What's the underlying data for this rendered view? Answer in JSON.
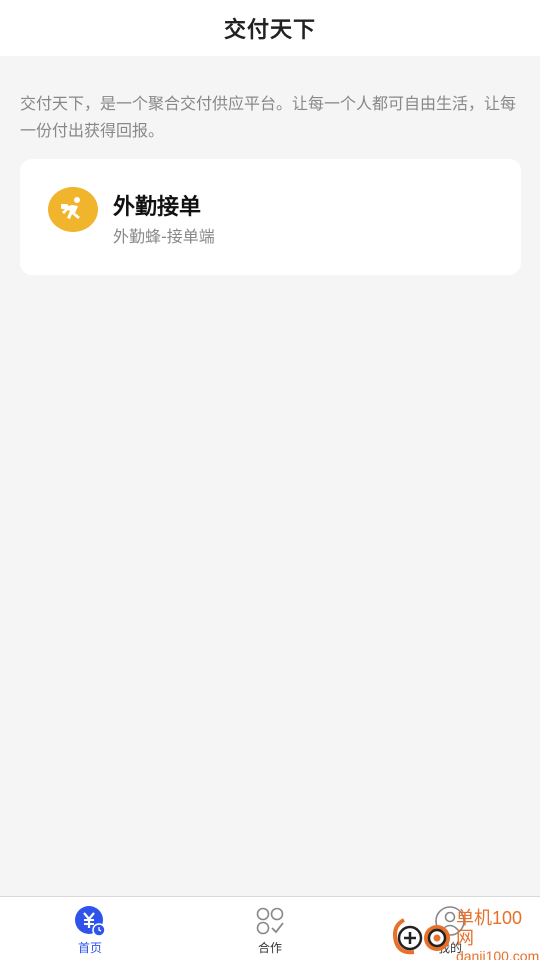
{
  "header": {
    "title": "交付天下"
  },
  "intro": {
    "text": "交付天下，是一个聚合交付供应平台。让每一个人都可自由生活，让每一份付出获得回报。"
  },
  "card": {
    "icon": "runner-icon",
    "title": "外勤接单",
    "subtitle": "外勤蜂-接单端"
  },
  "tabbar": {
    "tabs": [
      {
        "label": "首页",
        "icon": "home-yen-icon",
        "active": true
      },
      {
        "label": "合作",
        "icon": "cooperation-icon",
        "active": false
      },
      {
        "label": "我的",
        "icon": "profile-icon",
        "active": false
      }
    ]
  },
  "watermark": {
    "text": "单机100网",
    "url": "danji100.com"
  },
  "colors": {
    "accent": "#2f54eb",
    "card_icon_bg": "#f0b52d",
    "background": "#f5f5f5"
  }
}
